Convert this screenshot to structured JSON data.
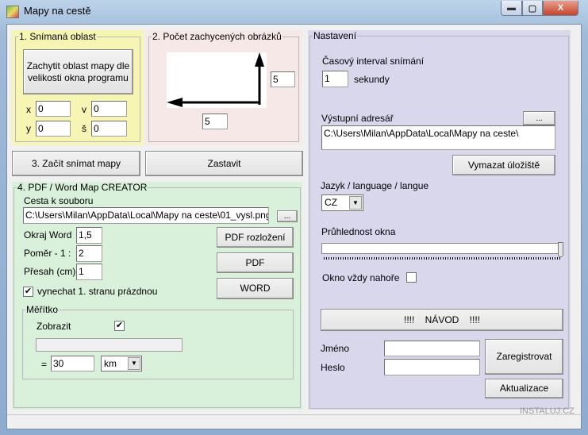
{
  "window": {
    "title": "Mapy na cestě",
    "minimize": "▬",
    "maximize": "▢",
    "close": "X"
  },
  "area": {
    "title": "1. Snímaná oblast",
    "capture_button": "Zachytit oblast mapy dle velikosti okna programu",
    "x_label": "x",
    "x_value": "0",
    "y_label": "y",
    "y_value": "0",
    "v_label": "v",
    "v_value": "0",
    "s_label": "š",
    "s_value": "0"
  },
  "count": {
    "title": "2. Počet zachycených obrázků",
    "vertical_value": "5",
    "horizontal_value": "5"
  },
  "actions": {
    "start": "3. Začít snímat mapy",
    "stop": "Zastavit"
  },
  "creator": {
    "title": "4. PDF / Word Map CREATOR",
    "path_label": "Cesta k souboru",
    "path_value": "C:\\Users\\Milan\\AppData\\Local\\Mapy na ceste\\01_vysl.png",
    "browse": "...",
    "margin_label": "Okraj Word",
    "margin_value": "1,5",
    "ratio_label": "Poměr - 1 :",
    "ratio_value": "2",
    "overlap_label": "Přesah (cm)",
    "overlap_value": "1",
    "skip_label": "vynechat 1. stranu prázdnou",
    "skip_checked": "✔",
    "pdf_layout": "PDF rozložení",
    "pdf": "PDF",
    "word": "WORD",
    "scale": {
      "title": "Měřítko",
      "show_label": "Zobrazit",
      "show_checked": "✔",
      "equals": "=",
      "value": "30",
      "unit": "km"
    }
  },
  "settings": {
    "title": "Nastavení",
    "interval_label": "Časový interval snímání",
    "interval_value": "1",
    "interval_unit": "sekundy",
    "output_label": "Výstupní adresář",
    "output_browse": "...",
    "output_value": "C:\\Users\\Milan\\AppData\\Local\\Mapy na ceste\\",
    "clear_storage": "Vymazat úložiště",
    "language_label": "Jazyk / language / langue",
    "language_value": "CZ",
    "transparency_label": "Průhlednost okna",
    "transparency_value": 100,
    "on_top_label": "Okno vždy nahoře",
    "manual": "!!!!    NÁVOD    !!!!",
    "name_label": "Jméno",
    "name_value": "",
    "password_label": "Heslo",
    "password_value": "",
    "register": "Zaregistrovat",
    "update": "Aktualizace"
  },
  "watermark": "INSTALUJ.CZ"
}
